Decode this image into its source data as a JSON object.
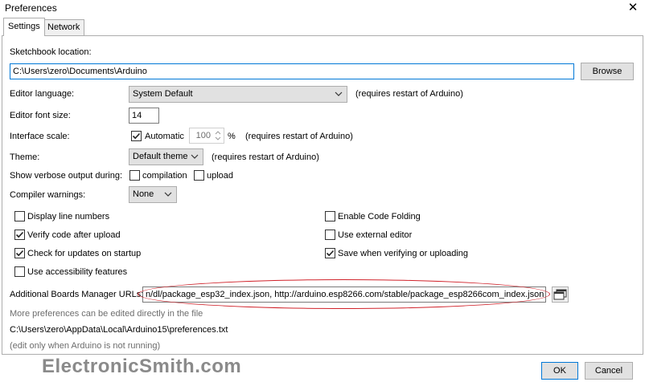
{
  "window": {
    "title": "Preferences"
  },
  "tabs": [
    {
      "label": "Settings",
      "active": true
    },
    {
      "label": "Network",
      "active": false
    }
  ],
  "sketchbook": {
    "label": "Sketchbook location:",
    "value": "C:\\Users\\zero\\Documents\\Arduino",
    "browse_label": "Browse"
  },
  "editor_language": {
    "label": "Editor language:",
    "value": "System Default",
    "note": "(requires restart of Arduino)"
  },
  "font_size": {
    "label": "Editor font size:",
    "value": "14"
  },
  "interface_scale": {
    "label": "Interface scale:",
    "automatic_label": "Automatic",
    "automatic_checked": true,
    "value": "100",
    "unit": "%",
    "note": "(requires restart of Arduino)"
  },
  "theme": {
    "label": "Theme:",
    "value": "Default theme",
    "note": "(requires restart of Arduino)"
  },
  "verbose": {
    "label": "Show verbose output during:",
    "compilation_label": "compilation",
    "compilation_checked": false,
    "upload_label": "upload",
    "upload_checked": false
  },
  "compiler_warnings": {
    "label": "Compiler warnings:",
    "value": "None"
  },
  "options_left": [
    {
      "label": "Display line numbers",
      "checked": false
    },
    {
      "label": "Verify code after upload",
      "checked": true
    },
    {
      "label": "Check for updates on startup",
      "checked": true
    },
    {
      "label": "Use accessibility features",
      "checked": false
    }
  ],
  "options_right": [
    {
      "label": "Enable Code Folding",
      "checked": false
    },
    {
      "label": "Use external editor",
      "checked": false
    },
    {
      "label": "Save when verifying or uploading",
      "checked": true
    }
  ],
  "boards_urls": {
    "label": "Additional Boards Manager URLs:",
    "value": "n/dl/package_esp32_index.json, http://arduino.esp8266.com/stable/package_esp8266com_index.json"
  },
  "footer": {
    "more_prefs": "More preferences can be edited directly in the file",
    "prefs_path": "C:\\Users\\zero\\AppData\\Local\\Arduino15\\preferences.txt",
    "edit_note": "(edit only when Arduino is not running)"
  },
  "buttons": {
    "ok": "OK",
    "cancel": "Cancel"
  },
  "watermark": "ElectronicSmith.com",
  "colors": {
    "highlight_oval": "#d0222a",
    "watermark": "#8a8a8a"
  }
}
